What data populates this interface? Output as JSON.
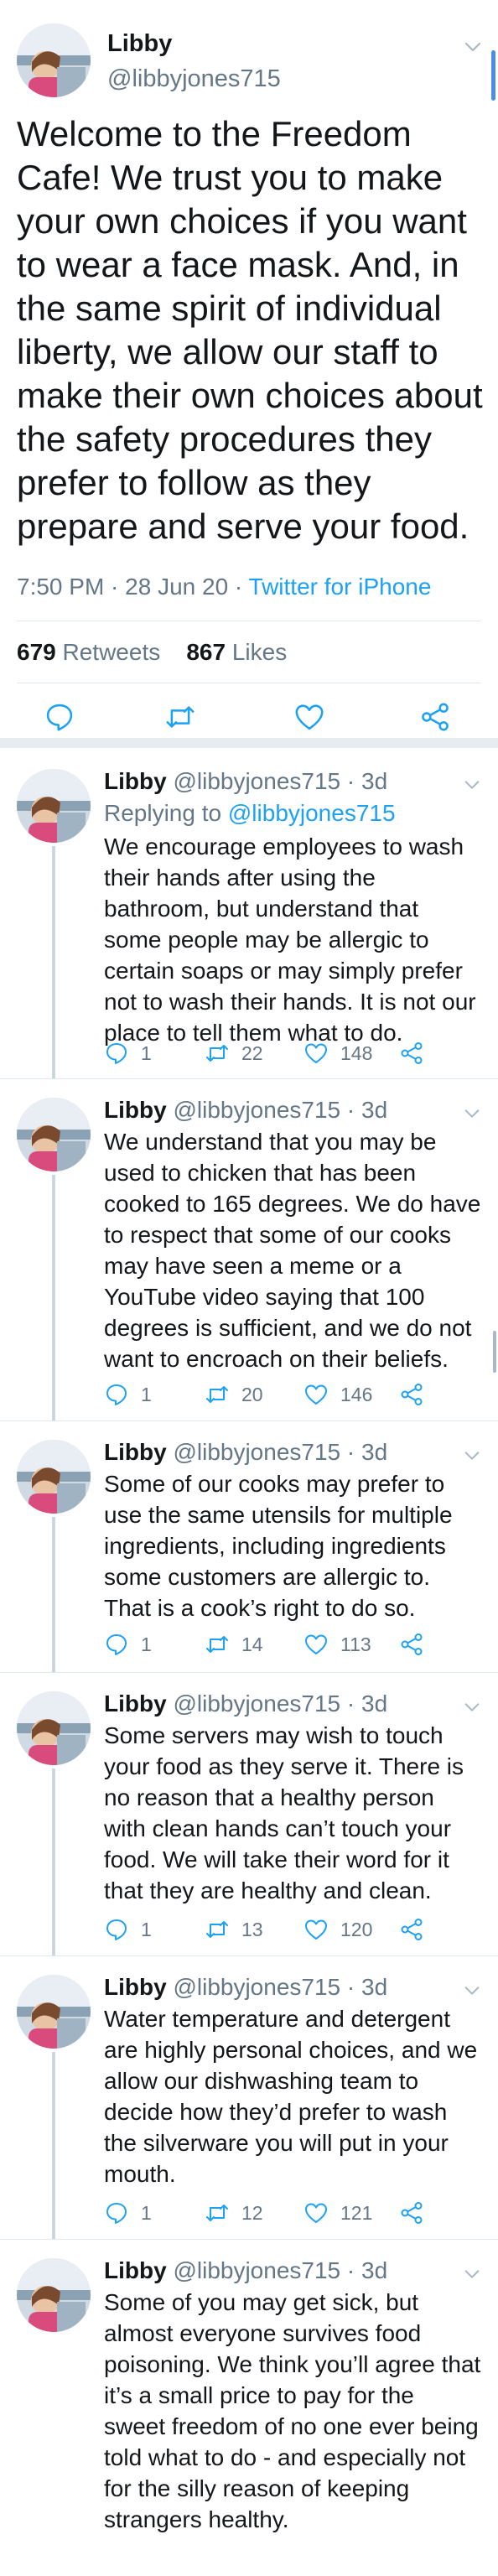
{
  "main_tweet": {
    "name": "Libby",
    "handle": "@libbyjones715",
    "text": "Welcome to the Freedom Cafe! We trust you to make your own choices if you want to wear a face mask. And, in the same spirit of individual liberty, we allow our staff to make their own choices about the safety procedures they prefer to follow as they prepare and serve your food.",
    "time": "7:50 PM · 28 Jun 20 · ",
    "source": "Twitter for iPhone",
    "retweets_count": "679",
    "retweets_label": "Retweets",
    "likes_count": "867",
    "likes_label": "Likes"
  },
  "icons": {
    "reply": "reply-icon",
    "retweet": "retweet-icon",
    "like": "heart-icon",
    "share": "share-icon",
    "menu": "chevron-down-icon"
  },
  "colors": {
    "link": "#1da1f2",
    "secondary_text": "#657786",
    "primary_text": "#14171a",
    "thread_line": "#ccd6dd"
  },
  "replies": [
    {
      "name": "Libby",
      "handle_time": "@libbyjones715 · 3d",
      "replying_prefix": "Replying to ",
      "replying_to": "@libbyjones715",
      "text": "We encourage employees to wash their hands after using the bathroom, but understand that some people may be allergic to certain soaps or may simply prefer not to wash their hands. It is not our place to tell them what to do.",
      "replies": "1",
      "retweets": "22",
      "likes": "148"
    },
    {
      "name": "Libby",
      "handle_time": "@libbyjones715 · 3d",
      "text": "We understand that you may be used to chicken that has been cooked to 165 degrees. We do have to respect that some of our cooks may have seen a meme or a YouTube video saying that 100 degrees is sufficient, and we do not want to encroach on their beliefs.",
      "replies": "1",
      "retweets": "20",
      "likes": "146"
    },
    {
      "name": "Libby",
      "handle_time": "@libbyjones715 · 3d",
      "text": "Some of our cooks may prefer to use the same utensils for multiple ingredients, including ingredients some customers are allergic to. That is a cook’s right to do so.",
      "replies": "1",
      "retweets": "14",
      "likes": "113"
    },
    {
      "name": "Libby",
      "handle_time": "@libbyjones715 · 3d",
      "text": "Some servers may wish to touch your food as they serve it. There is no reason that a healthy person with clean hands can’t touch your food. We will take their word for it that they are healthy and clean.",
      "replies": "1",
      "retweets": "13",
      "likes": "120"
    },
    {
      "name": "Libby",
      "handle_time": "@libbyjones715 · 3d",
      "text": "Water temperature and detergent are highly personal choices, and we allow our dishwashing team to decide how they’d prefer to wash the silverware you will put in your mouth.",
      "replies": "1",
      "retweets": "12",
      "likes": "121"
    },
    {
      "name": "Libby",
      "handle_time": "@libbyjones715 · 3d",
      "text": "Some of you may get sick, but almost everyone survives food poisoning. We think you’ll agree that it’s a small price to pay for the sweet freedom of no one ever being told what to do - and especially not for the silly reason of keeping strangers healthy."
    }
  ]
}
